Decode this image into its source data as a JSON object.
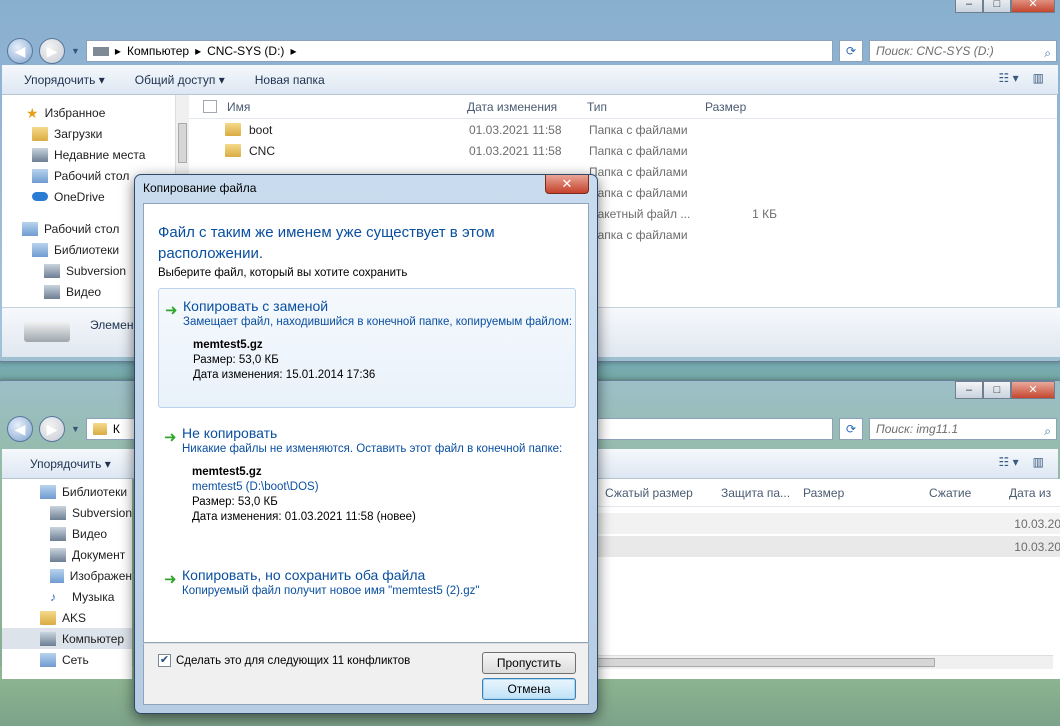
{
  "window_top": {
    "address": [
      "Компьютер",
      "CNC-SYS (D:)"
    ],
    "search_placeholder": "Поиск: CNC-SYS (D:)",
    "toolbar": {
      "organize": "Упорядочить",
      "share": "Общий доступ",
      "new_folder": "Новая папка"
    },
    "nav": [
      {
        "label": "Избранное",
        "icon": "star-icon"
      },
      {
        "label": "Загрузки",
        "icon": "folder-icon"
      },
      {
        "label": "Недавние места",
        "icon": "folder-icon"
      },
      {
        "label": "Рабочий стол",
        "icon": "desktop-icon"
      },
      {
        "label": "OneDrive",
        "icon": "cloud-icon"
      },
      {
        "label": "Рабочий стол",
        "icon": "desktop-icon"
      },
      {
        "label": "Библиотеки",
        "icon": "library-icon"
      },
      {
        "label": "Subversion",
        "icon": "folder-icon"
      },
      {
        "label": "Видео",
        "icon": "video-icon"
      }
    ],
    "columns": [
      "Имя",
      "Дата изменения",
      "Тип",
      "Размер"
    ],
    "files": [
      {
        "name": "boot",
        "date": "01.03.2021 11:58",
        "type": "Папка с файлами",
        "size": ""
      },
      {
        "name": "CNC",
        "date": "01.03.2021 11:58",
        "type": "Папка с файлами",
        "size": ""
      },
      {
        "name": "",
        "date": "",
        "type": "Папка с файлами",
        "size": ""
      },
      {
        "name": "",
        "date": "",
        "type": "Папка с файлами",
        "size": ""
      },
      {
        "name": "",
        "date": "",
        "type": "Пакетный файл ...",
        "size": "1 КБ"
      },
      {
        "name": "",
        "date": "",
        "type": "Папка с файлами",
        "size": ""
      }
    ],
    "status_label": "Элемен"
  },
  "window_bottom": {
    "address_fragment": "К",
    "search_placeholder": "Поиск: img11.1",
    "toolbar": {
      "organize": "Упорядочить"
    },
    "nav": [
      {
        "label": "Библиотеки",
        "icon": "library-icon"
      },
      {
        "label": "Subversion",
        "icon": "folder-icon"
      },
      {
        "label": "Видео",
        "icon": "video-icon"
      },
      {
        "label": "Документ",
        "icon": "document-icon"
      },
      {
        "label": "Изображен",
        "icon": "image-icon"
      },
      {
        "label": "Музыка",
        "icon": "music-icon"
      },
      {
        "label": "AKS",
        "icon": "folder-icon"
      },
      {
        "label": "Компьютер",
        "icon": "computer-icon"
      },
      {
        "label": "Сеть",
        "icon": "network-icon"
      }
    ],
    "columns": [
      "Сжатый размер",
      "Защита па...",
      "Размер",
      "Сжатие",
      "Дата из"
    ],
    "dates": [
      "10.03.20",
      "10.03.20"
    ]
  },
  "dialog": {
    "title": "Копирование файла",
    "main_instruction": "Файл с таким же именем уже существует в этом расположении.",
    "sub_instruction": "Выберите файл, который вы хотите сохранить",
    "option_replace": {
      "title": "Копировать с заменой",
      "desc": "Замещает файл, находившийся в конечной папке, копируемым файлом:",
      "file_name": "memtest5.gz",
      "size": "Размер: 53,0 КБ",
      "date": "Дата изменения: 15.01.2014 17:36"
    },
    "option_skip": {
      "title": "Не копировать",
      "desc": "Никакие файлы не изменяются. Оставить этот файл в конечной папке:",
      "file_name": "memtest5.gz",
      "location": "memtest5 (D:\\boot\\DOS)",
      "size": "Размер: 53,0 КБ",
      "date": "Дата изменения: 01.03.2021 11:58 (новее)"
    },
    "option_both": {
      "title": "Копировать, но сохранить оба файла",
      "desc": "Копируемый файл получит новое имя \"memtest5 (2).gz\""
    },
    "checkbox_label": "Сделать это для следующих 11 конфликтов",
    "checkbox_checked": true,
    "skip_button": "Пропустить",
    "cancel_button": "Отмена"
  },
  "colors": {
    "accent_blue": "#0a4fa0",
    "arrow_green": "#2fa52a",
    "close_red": "#c4422b"
  }
}
